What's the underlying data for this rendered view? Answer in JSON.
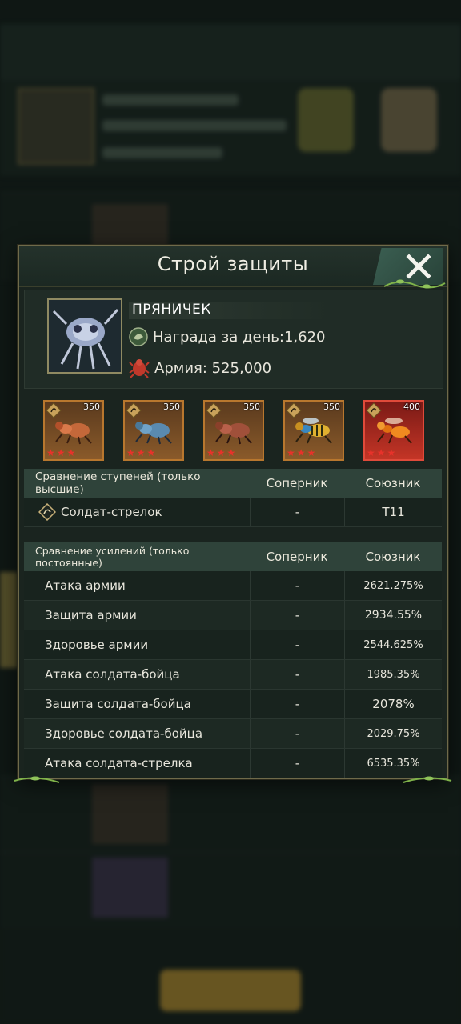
{
  "dialog": {
    "title": "Строй защиты",
    "close_icon": "close-x-icon"
  },
  "profile": {
    "name": "ПРЯНИЧЕК",
    "reward_label": "Награда за день:1,620",
    "army_label": "Армия: 525,000"
  },
  "slots": [
    {
      "level": "350",
      "color": "#b8772e",
      "stars": "★★★"
    },
    {
      "level": "350",
      "color": "#b8772e",
      "stars": "★★★"
    },
    {
      "level": "350",
      "color": "#b8772e",
      "stars": "★★★"
    },
    {
      "level": "350",
      "color": "#b8772e",
      "stars": "★★★"
    },
    {
      "level": "400",
      "color": "#e04a3a",
      "stars": "★★★"
    }
  ],
  "tier_table": {
    "header": {
      "title": "Сравнение ступеней (только высшие)",
      "rival": "Соперник",
      "ally": "Союзник"
    },
    "rows": [
      {
        "name": "Солдат-стрелок",
        "rival": "-",
        "ally": "T11"
      }
    ]
  },
  "boost_table": {
    "header": {
      "title": "Сравнение усилений (только постоянные)",
      "rival": "Соперник",
      "ally": "Союзник"
    },
    "rows": [
      {
        "name": "Атака армии",
        "rival": "-",
        "ally": "2621.275%"
      },
      {
        "name": "Защита армии",
        "rival": "-",
        "ally": "2934.55%"
      },
      {
        "name": "Здоровье армии",
        "rival": "-",
        "ally": "2544.625%"
      },
      {
        "name": "Атака солдата-бойца",
        "rival": "-",
        "ally": "1985.35%"
      },
      {
        "name": "Защита солдата-бойца",
        "rival": "-",
        "ally": "2078%"
      },
      {
        "name": "Здоровье солдата-бойца",
        "rival": "-",
        "ally": "2029.75%"
      },
      {
        "name": "Атака солдата-стрелка",
        "rival": "-",
        "ally": "6535.35%"
      }
    ]
  }
}
